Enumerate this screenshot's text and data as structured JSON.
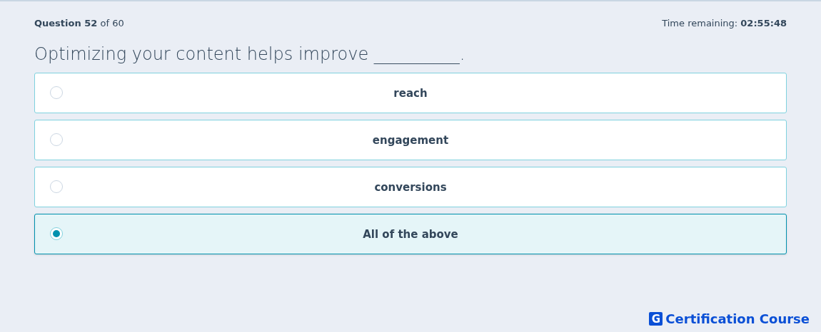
{
  "progress": "**Question 52** of 60",
  "timer": "Time remaining: **02:55:48**",
  "question": "Optimizing your content helps improve __________.",
  "options": [
    {
      "label": "reach",
      "selected": false
    },
    {
      "label": "engagement",
      "selected": false
    },
    {
      "label": "conversions",
      "selected": false
    },
    {
      "label": "All of the above",
      "selected": true
    }
  ],
  "brand": {
    "mark": "G",
    "name": "Certification Course"
  }
}
